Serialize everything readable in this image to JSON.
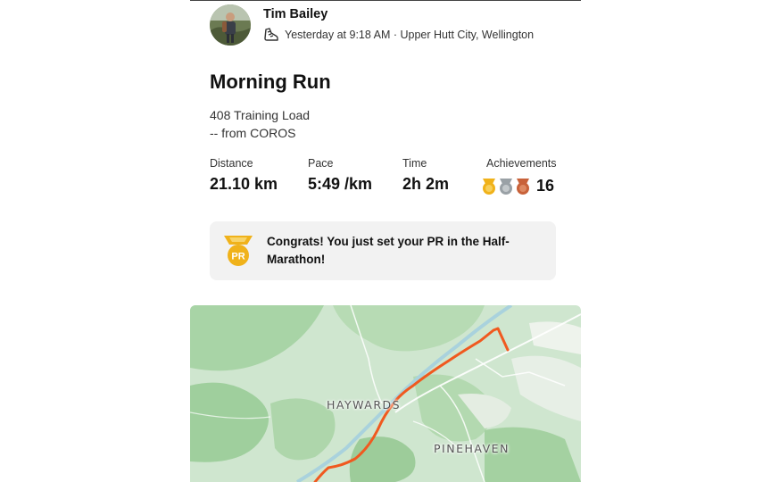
{
  "athlete": {
    "name": "Tim Bailey"
  },
  "activity": {
    "meta": "Yesterday at 9:18 AM · Upper Hutt City, Wellington",
    "title": "Morning Run",
    "training_load": "408 Training Load",
    "source": "-- from COROS"
  },
  "stats": [
    {
      "label": "Distance",
      "value": "21.10 km"
    },
    {
      "label": "Pace",
      "value": "5:49 /km"
    },
    {
      "label": "Time",
      "value": "2h 2m"
    }
  ],
  "achievements": {
    "label": "Achievements",
    "count": "16",
    "medal_colors": [
      "#f0b21a",
      "#9aa1a6",
      "#c8623a"
    ]
  },
  "pr": {
    "badge_text": "PR",
    "message": "Congrats! You just set your PR in the Half-Marathon!"
  },
  "map": {
    "labels": [
      "HAYWARDS",
      "PINEHAVEN"
    ],
    "route_color": "#f0591f"
  },
  "colors": {
    "accent": "#f0591f",
    "badge_gold": "#f0b21a"
  }
}
